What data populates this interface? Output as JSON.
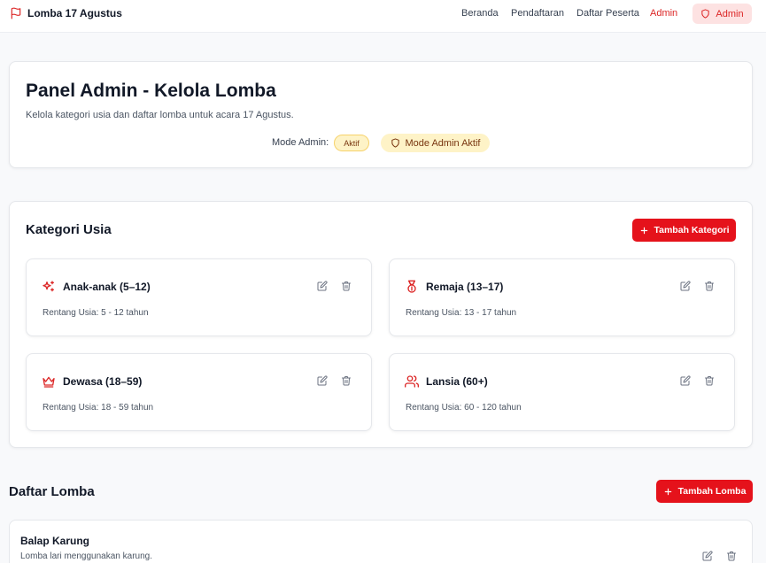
{
  "nav": {
    "brand": "Lomba 17 Agustus",
    "links": [
      "Beranda",
      "Pendaftaran",
      "Daftar Peserta",
      "Admin"
    ],
    "admin_button": "Admin"
  },
  "header": {
    "title": "Panel Admin - Kelola Lomba",
    "subtitle": "Kelola kategori usia dan daftar lomba untuk acara 17 Agustus.",
    "mode_label": "Mode Admin:",
    "mode_badge": "Aktif",
    "mode_active_badge": "Mode Admin Aktif"
  },
  "categories": {
    "title": "Kategori Usia",
    "add_button": "Tambah Kategori",
    "items": [
      {
        "name": "Anak-anak (5–12)",
        "range": "Rentang Usia: 5 - 12 tahun",
        "icon": "sparkles-icon"
      },
      {
        "name": "Remaja (13–17)",
        "range": "Rentang Usia: 13 - 17 tahun",
        "icon": "medal-icon"
      },
      {
        "name": "Dewasa (18–59)",
        "range": "Rentang Usia: 18 - 59 tahun",
        "icon": "crown-icon"
      },
      {
        "name": "Lansia (60+)",
        "range": "Rentang Usia: 60 - 120 tahun",
        "icon": "users-icon"
      }
    ]
  },
  "races": {
    "title": "Daftar Lomba",
    "add_button": "Tambah Lomba",
    "items": [
      {
        "name": "Balap Karung",
        "description": "Lomba lari menggunakan karung."
      }
    ]
  },
  "colors": {
    "accent": "#e5121b",
    "badge_bg": "#fef3c7"
  }
}
